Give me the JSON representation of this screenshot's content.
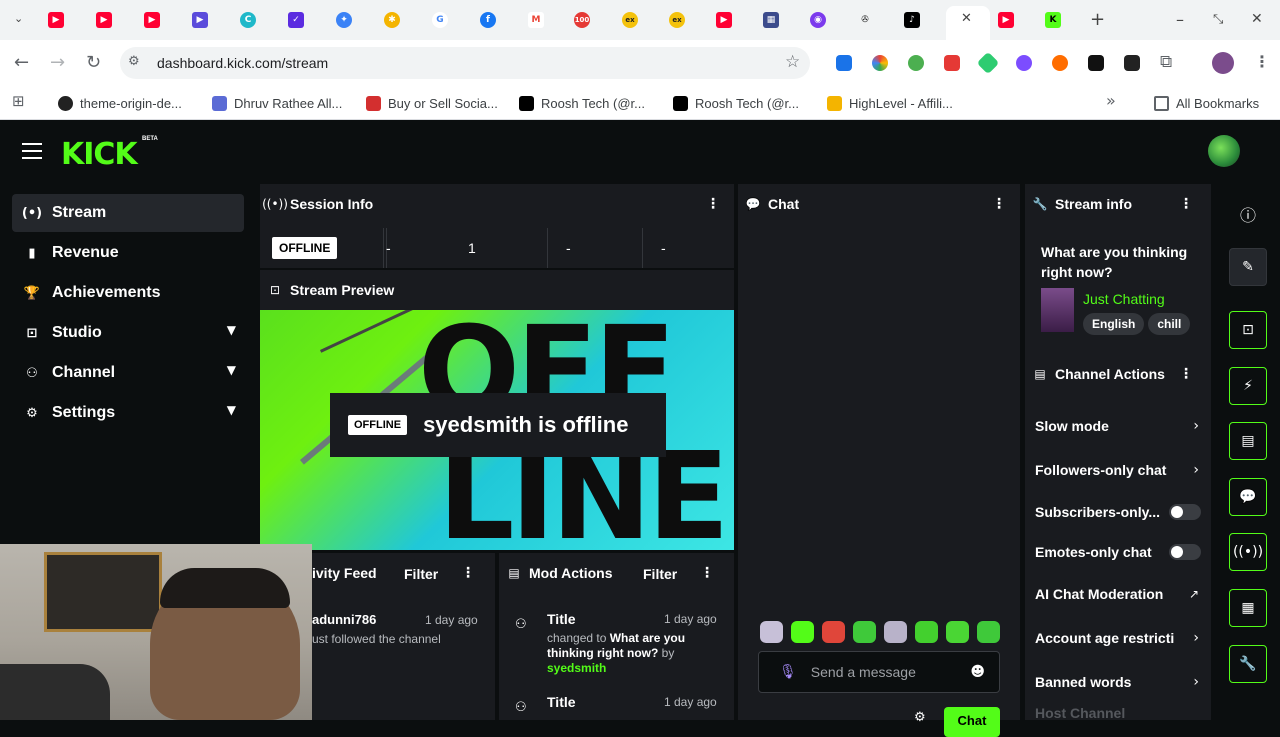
{
  "browser": {
    "url": "dashboard.kick.com/stream",
    "bookmarks": [
      "theme-origin-de...",
      "Dhruv Rathee All...",
      "Buy or Sell Socia...",
      "Roosh Tech (@r...",
      "Roosh Tech (@r...",
      "HighLevel - Affili..."
    ],
    "all_bookmarks": "All Bookmarks",
    "more_bookmarks": "»",
    "new_tab": "+",
    "close_tab": "✕"
  },
  "kick": {
    "logo": "KICK",
    "beta": "BETA",
    "nav": [
      {
        "label": "Stream",
        "icon": "(•)"
      },
      {
        "label": "Revenue",
        "icon": "▮"
      },
      {
        "label": "Achievements",
        "icon": "🏆"
      },
      {
        "label": "Studio",
        "icon": "⊡"
      },
      {
        "label": "Channel",
        "icon": "⚇"
      },
      {
        "label": "Settings",
        "icon": "⚙"
      }
    ],
    "session": {
      "title": "Session Info",
      "status": "OFFLINE",
      "stats": [
        "-",
        "1",
        "-",
        "-"
      ]
    },
    "preview": {
      "title": "Stream Preview",
      "badge": "OFFLINE",
      "message": "syedsmith is offline",
      "bg_word_top": "OFF",
      "bg_word_bottom": "LINE"
    },
    "activity": {
      "title": "ivity Feed",
      "filter": "Filter",
      "user": "adunni786",
      "time": "1 day ago",
      "text": "ust followed the channel"
    },
    "mod": {
      "title": "Mod Actions",
      "filter": "Filter",
      "items": [
        {
          "title": "Title",
          "time": "1 day ago",
          "text": "changed to ",
          "bold": "What are you thinking right now?",
          "by": " by ",
          "user": "syedsmith"
        },
        {
          "title": "Title",
          "time": "1 day ago"
        }
      ]
    },
    "chat": {
      "title": "Chat",
      "placeholder": "Send a message",
      "button": "Chat"
    },
    "stream_info": {
      "title": "Stream info",
      "question": "What are you thinking right now?",
      "category": "Just Chatting",
      "tags": [
        "English",
        "chill"
      ]
    },
    "channel_actions": {
      "title": "Channel Actions",
      "rows": [
        {
          "label": "Slow mode",
          "kind": "arrow"
        },
        {
          "label": "Followers-only chat",
          "kind": "arrow"
        },
        {
          "label": "Subscribers-only...",
          "kind": "toggle"
        },
        {
          "label": "Emotes-only chat",
          "kind": "toggle"
        },
        {
          "label": "AI Chat Moderation",
          "kind": "external"
        },
        {
          "label": "Account age restricti",
          "kind": "arrow"
        },
        {
          "label": "Banned words",
          "kind": "arrow"
        },
        {
          "label": "Host Channel",
          "kind": "none"
        }
      ]
    },
    "colors": {
      "accent": "#53fc18",
      "panel": "#191b1f",
      "bg": "#0b0e0f"
    }
  }
}
